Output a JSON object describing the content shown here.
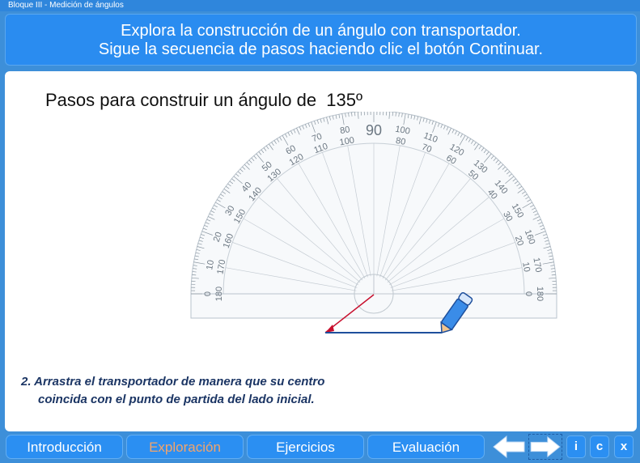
{
  "window": {
    "title": "Bloque III - Medición de ángulos"
  },
  "header": {
    "line1": "Explora la construcción de un ángulo con transportador.",
    "line2": "Sigue la secuencia de pasos haciendo clic el botón Continuar."
  },
  "main": {
    "title": "Pasos para construir un ángulo de",
    "angle_value": "135",
    "degree_symbol": "º",
    "protractor": {
      "center_label": "90",
      "outer_labels": [
        "0",
        "10",
        "20",
        "30",
        "40",
        "50",
        "60",
        "70",
        "80",
        "90",
        "100",
        "110",
        "120",
        "130",
        "140",
        "150",
        "160",
        "170",
        "180"
      ],
      "inner_labels": [
        "180",
        "170",
        "160",
        "150",
        "140",
        "130",
        "120",
        "110",
        "100",
        "90",
        "80",
        "70",
        "60",
        "50",
        "40",
        "30",
        "20",
        "10",
        "0"
      ]
    },
    "instruction_line1": "2. Arrastra el transportador de manera que su centro",
    "instruction_line2": "coincida con el punto de partida del lado inicial."
  },
  "nav": {
    "tabs": [
      "Introducción",
      "Exploración",
      "Ejercicios",
      "Evaluación"
    ],
    "active_tab": "Exploración",
    "info_label": "i",
    "credits_label": "c",
    "close_label": "x"
  },
  "colors": {
    "accent": "#2a8cf0",
    "active_tab_text": "#f3a46b",
    "line_red": "#c8102e",
    "instruction_text": "#1b3564"
  }
}
